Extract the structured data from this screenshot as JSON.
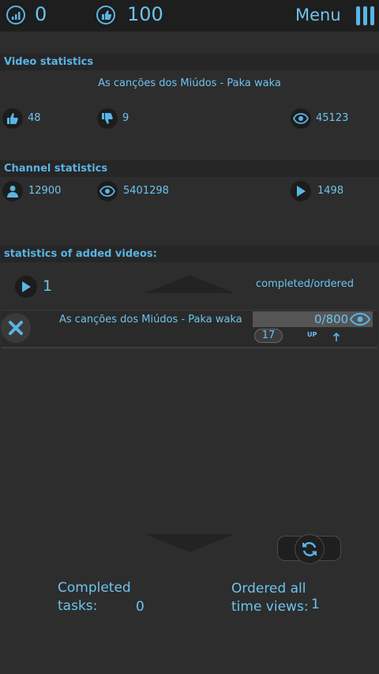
{
  "topbar": {
    "stat_left": "0",
    "stat_right": "100",
    "menu_label": "Menu"
  },
  "video": {
    "header": "Video statistics",
    "title": "As canções dos Miúdos - Paka waka",
    "likes": "48",
    "dislikes": "9",
    "views": "45123"
  },
  "channel": {
    "header": "Channel statistics",
    "subscribers": "12900",
    "views": "5401298",
    "videos": "1498"
  },
  "added": {
    "header": "statistics of added videos:",
    "count": "1",
    "completed_ordered_label": "completed/ordered",
    "item": {
      "title": "As canções dos Miúdos - Paka waka",
      "progress_text": "0/800",
      "level": "17",
      "up_label": "UP"
    }
  },
  "footer": {
    "completed_line1": "Completed",
    "completed_line2": "tasks:",
    "completed_value": "0",
    "ordered_line1": "Ordered all",
    "ordered_line2": "time views:",
    "ordered_value": "1"
  },
  "colors": {
    "accent": "#5ab4e5",
    "background": "#2d2d2d",
    "header_bg": "#262626"
  }
}
